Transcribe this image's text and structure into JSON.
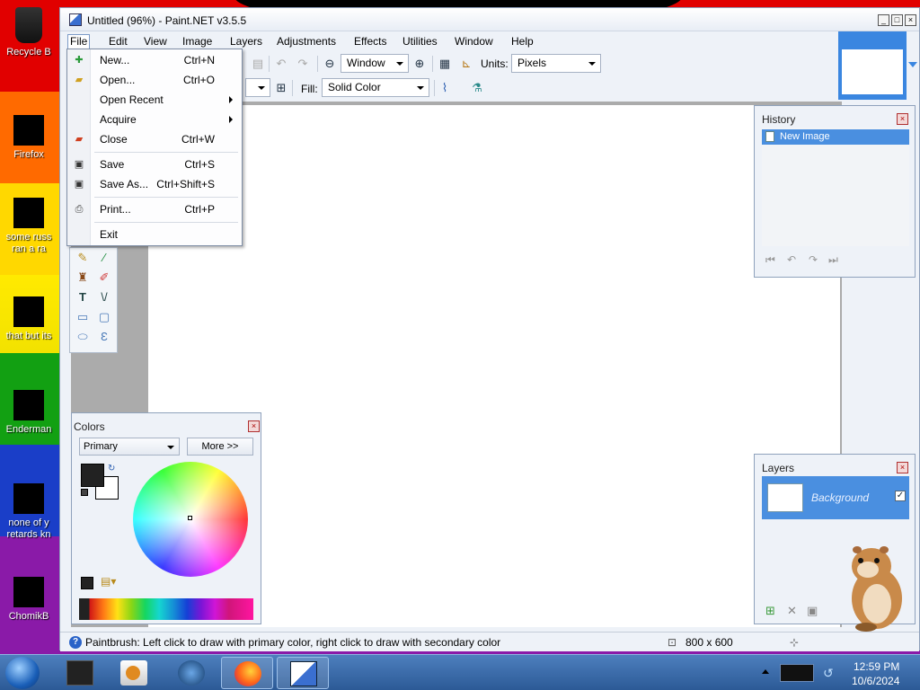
{
  "desktop": {
    "icons": [
      {
        "label": "Recycle B"
      },
      {
        "label": "Firefox"
      },
      {
        "label": "some russ ran a ra"
      },
      {
        "label": "that but its"
      },
      {
        "label": "Enderman"
      },
      {
        "label": "none of y retards kn"
      },
      {
        "label": "ChomikB"
      }
    ]
  },
  "window": {
    "title": "Untitled (96%) - Paint.NET v3.5.5",
    "menu": [
      "File",
      "Edit",
      "View",
      "Image",
      "Layers",
      "Adjustments",
      "Effects",
      "Utilities",
      "Window",
      "Help"
    ],
    "toolbar": {
      "zoom_mode": "Window",
      "units_label": "Units:",
      "units_value": "Pixels",
      "fill_label": "Fill:",
      "fill_value": "Solid Color"
    }
  },
  "file_menu": {
    "items": [
      {
        "label": "New...",
        "shortcut": "Ctrl+N"
      },
      {
        "label": "Open...",
        "shortcut": "Ctrl+O"
      },
      {
        "label": "Open Recent",
        "shortcut": ""
      },
      {
        "label": "Acquire",
        "shortcut": ""
      },
      {
        "label": "Close",
        "shortcut": "Ctrl+W"
      },
      {
        "label": "Save",
        "shortcut": "Ctrl+S"
      },
      {
        "label": "Save As...",
        "shortcut": "Ctrl+Shift+S"
      },
      {
        "label": "Print...",
        "shortcut": "Ctrl+P"
      },
      {
        "label": "Exit",
        "shortcut": ""
      }
    ]
  },
  "history": {
    "title": "History",
    "items": [
      "New Image"
    ]
  },
  "layers": {
    "title": "Layers",
    "items": [
      {
        "name": "Background",
        "visible_mark": "✓"
      }
    ]
  },
  "colors": {
    "title": "Colors",
    "mode": "Primary",
    "more_label": "More >>",
    "primary": "#222222",
    "secondary": "#ffffff"
  },
  "status": {
    "help_text": "Paintbrush: Left click to draw with primary color, right click to draw with secondary color",
    "image_size": "800 x 600"
  },
  "taskbar": {
    "time": "12:59 PM",
    "date": "10/6/2024"
  },
  "theme": {
    "accent": "#3a86e0",
    "selection": "#4a8fe0"
  }
}
